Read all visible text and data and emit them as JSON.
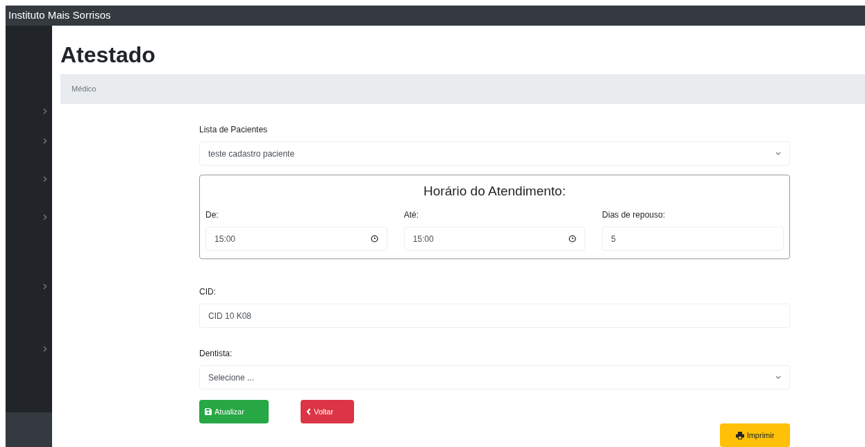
{
  "topbar": {
    "title": "Instituto Mais Sorrisos"
  },
  "page": {
    "heading": "Atestado",
    "breadcrumb": "Médico"
  },
  "patient": {
    "label": "Lista de Pacientes",
    "value": "teste cadastro paciente"
  },
  "schedule": {
    "legend": "Horário do Atendimento:",
    "fields": [
      {
        "kind": "time",
        "label": "De:",
        "value": "15:00"
      },
      {
        "kind": "time",
        "label": "Até:",
        "value": "15:00"
      },
      {
        "kind": "number",
        "label": "Dias de repouso:",
        "value": "5"
      }
    ]
  },
  "cid": {
    "label": "CID:",
    "value": "CID 10 K08"
  },
  "dentist": {
    "label": "Dentista:",
    "value": "Selecione ..."
  },
  "buttons": [
    {
      "kind": "save",
      "label": "Atualizar"
    },
    {
      "kind": "back",
      "label": "Voltar"
    },
    {
      "kind": "print",
      "label": "Imprimir"
    }
  ]
}
